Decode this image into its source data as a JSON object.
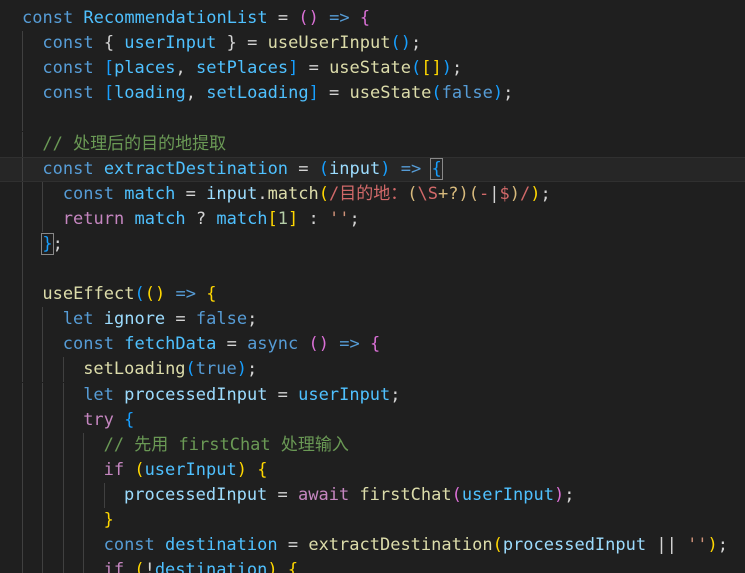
{
  "theme": {
    "background": "#1f1f1f",
    "current_line": "#262626",
    "indent_guide": "#404040",
    "indent_guide_active": "#707070"
  },
  "code_lines": [
    {
      "indent": 0,
      "tokens": [
        [
          "const ",
          "#569cd6"
        ],
        [
          "RecommendationList",
          "#4fc1ff"
        ],
        [
          " = ",
          "#d4d4d4"
        ],
        [
          "()",
          "#da70d6"
        ],
        [
          " ",
          "#d4d4d4"
        ],
        [
          "=>",
          "#569cd6"
        ],
        [
          " ",
          "#d4d4d4"
        ],
        [
          "{",
          "#da70d6"
        ]
      ]
    },
    {
      "indent": 1,
      "tokens": [
        [
          "const ",
          "#569cd6"
        ],
        [
          "{",
          "#d4d4d4"
        ],
        [
          " userInput ",
          "#4fc1ff"
        ],
        [
          "}",
          "#d4d4d4"
        ],
        [
          " = ",
          "#d4d4d4"
        ],
        [
          "useUserInput",
          "#dcdcaa"
        ],
        [
          "()",
          "#179fff"
        ],
        [
          ";",
          "#d4d4d4"
        ]
      ]
    },
    {
      "indent": 1,
      "tokens": [
        [
          "const ",
          "#569cd6"
        ],
        [
          "[",
          "#179fff"
        ],
        [
          "places",
          "#4fc1ff"
        ],
        [
          ", ",
          "#d4d4d4"
        ],
        [
          "setPlaces",
          "#4fc1ff"
        ],
        [
          "]",
          "#179fff"
        ],
        [
          " = ",
          "#d4d4d4"
        ],
        [
          "useState",
          "#dcdcaa"
        ],
        [
          "(",
          "#179fff"
        ],
        [
          "[]",
          "#ffd700"
        ],
        [
          ")",
          "#179fff"
        ],
        [
          ";",
          "#d4d4d4"
        ]
      ]
    },
    {
      "indent": 1,
      "tokens": [
        [
          "const ",
          "#569cd6"
        ],
        [
          "[",
          "#179fff"
        ],
        [
          "loading",
          "#4fc1ff"
        ],
        [
          ", ",
          "#d4d4d4"
        ],
        [
          "setLoading",
          "#4fc1ff"
        ],
        [
          "]",
          "#179fff"
        ],
        [
          " = ",
          "#d4d4d4"
        ],
        [
          "useState",
          "#dcdcaa"
        ],
        [
          "(",
          "#179fff"
        ],
        [
          "false",
          "#569cd6"
        ],
        [
          ")",
          "#179fff"
        ],
        [
          ";",
          "#d4d4d4"
        ]
      ]
    },
    {
      "indent": 1,
      "tokens": []
    },
    {
      "indent": 1,
      "tokens": [
        [
          "// 处理后的目的地提取",
          "#6a9955"
        ]
      ]
    },
    {
      "indent": 1,
      "current": true,
      "tokens": [
        [
          "const ",
          "#569cd6"
        ],
        [
          "extractDestination",
          "#4fc1ff"
        ],
        [
          " = ",
          "#d4d4d4"
        ],
        [
          "(",
          "#179fff"
        ],
        [
          "input",
          "#9cdcfe"
        ],
        [
          ")",
          "#179fff"
        ],
        [
          " ",
          "#d4d4d4"
        ],
        [
          "=>",
          "#569cd6"
        ],
        [
          " ",
          "#d4d4d4"
        ],
        [
          "{",
          "#179fff",
          "bracket"
        ]
      ]
    },
    {
      "indent": 2,
      "tokens": [
        [
          "const ",
          "#569cd6"
        ],
        [
          "match",
          "#4fc1ff"
        ],
        [
          " = ",
          "#d4d4d4"
        ],
        [
          "input",
          "#9cdcfe"
        ],
        [
          ".",
          "#d4d4d4"
        ],
        [
          "match",
          "#dcdcaa"
        ],
        [
          "(",
          "#ffd700"
        ],
        [
          "/",
          "#d16969"
        ],
        [
          "目的地：",
          "#d16969"
        ],
        [
          "(",
          "#d7ba7d"
        ],
        [
          "\\S",
          "#d16969"
        ],
        [
          "+?",
          "#d7ba7d"
        ],
        [
          ")",
          "#d7ba7d"
        ],
        [
          "(",
          "#d7ba7d"
        ],
        [
          "-",
          "#d16969"
        ],
        [
          "|",
          "#d4d4d4"
        ],
        [
          "$",
          "#d16969"
        ],
        [
          ")",
          "#d7ba7d"
        ],
        [
          "/",
          "#d16969"
        ],
        [
          ")",
          "#ffd700"
        ],
        [
          ";",
          "#d4d4d4"
        ]
      ]
    },
    {
      "indent": 2,
      "tokens": [
        [
          "return ",
          "#c586c0"
        ],
        [
          "match",
          "#4fc1ff"
        ],
        [
          " ? ",
          "#d4d4d4"
        ],
        [
          "match",
          "#4fc1ff"
        ],
        [
          "[",
          "#ffd700"
        ],
        [
          "1",
          "#b5cea8"
        ],
        [
          "]",
          "#ffd700"
        ],
        [
          " : ",
          "#d4d4d4"
        ],
        [
          "''",
          "#ce9178"
        ],
        [
          ";",
          "#d4d4d4"
        ]
      ]
    },
    {
      "indent": 1,
      "tokens": [
        [
          "}",
          "#179fff",
          "bracket"
        ],
        [
          ";",
          "#d4d4d4"
        ]
      ]
    },
    {
      "indent": 1,
      "tokens": []
    },
    {
      "indent": 1,
      "tokens": [
        [
          "useEffect",
          "#dcdcaa"
        ],
        [
          "(",
          "#179fff"
        ],
        [
          "()",
          "#ffd700"
        ],
        [
          " ",
          "#d4d4d4"
        ],
        [
          "=>",
          "#569cd6"
        ],
        [
          " ",
          "#d4d4d4"
        ],
        [
          "{",
          "#ffd700"
        ]
      ]
    },
    {
      "indent": 2,
      "tokens": [
        [
          "let ",
          "#569cd6"
        ],
        [
          "ignore",
          "#9cdcfe"
        ],
        [
          " = ",
          "#d4d4d4"
        ],
        [
          "false",
          "#569cd6"
        ],
        [
          ";",
          "#d4d4d4"
        ]
      ]
    },
    {
      "indent": 2,
      "tokens": [
        [
          "const ",
          "#569cd6"
        ],
        [
          "fetchData",
          "#4fc1ff"
        ],
        [
          " = ",
          "#d4d4d4"
        ],
        [
          "async ",
          "#569cd6"
        ],
        [
          "()",
          "#da70d6"
        ],
        [
          " ",
          "#d4d4d4"
        ],
        [
          "=>",
          "#569cd6"
        ],
        [
          " ",
          "#d4d4d4"
        ],
        [
          "{",
          "#da70d6"
        ]
      ]
    },
    {
      "indent": 3,
      "tokens": [
        [
          "setLoading",
          "#dcdcaa"
        ],
        [
          "(",
          "#179fff"
        ],
        [
          "true",
          "#569cd6"
        ],
        [
          ")",
          "#179fff"
        ],
        [
          ";",
          "#d4d4d4"
        ]
      ]
    },
    {
      "indent": 3,
      "tokens": [
        [
          "let ",
          "#569cd6"
        ],
        [
          "processedInput",
          "#9cdcfe"
        ],
        [
          " = ",
          "#d4d4d4"
        ],
        [
          "userInput",
          "#4fc1ff"
        ],
        [
          ";",
          "#d4d4d4"
        ]
      ]
    },
    {
      "indent": 3,
      "tokens": [
        [
          "try ",
          "#c586c0"
        ],
        [
          "{",
          "#179fff"
        ]
      ]
    },
    {
      "indent": 4,
      "tokens": [
        [
          "// 先用 firstChat 处理输入",
          "#6a9955"
        ]
      ]
    },
    {
      "indent": 4,
      "tokens": [
        [
          "if ",
          "#c586c0"
        ],
        [
          "(",
          "#ffd700"
        ],
        [
          "userInput",
          "#4fc1ff"
        ],
        [
          ")",
          "#ffd700"
        ],
        [
          " ",
          "#d4d4d4"
        ],
        [
          "{",
          "#ffd700"
        ]
      ]
    },
    {
      "indent": 5,
      "tokens": [
        [
          "processedInput",
          "#9cdcfe"
        ],
        [
          " = ",
          "#d4d4d4"
        ],
        [
          "await ",
          "#c586c0"
        ],
        [
          "firstChat",
          "#dcdcaa"
        ],
        [
          "(",
          "#da70d6"
        ],
        [
          "userInput",
          "#4fc1ff"
        ],
        [
          ")",
          "#da70d6"
        ],
        [
          ";",
          "#d4d4d4"
        ]
      ]
    },
    {
      "indent": 4,
      "tokens": [
        [
          "}",
          "#ffd700"
        ]
      ]
    },
    {
      "indent": 4,
      "tokens": [
        [
          "const ",
          "#569cd6"
        ],
        [
          "destination",
          "#4fc1ff"
        ],
        [
          " = ",
          "#d4d4d4"
        ],
        [
          "extractDestination",
          "#dcdcaa"
        ],
        [
          "(",
          "#ffd700"
        ],
        [
          "processedInput",
          "#9cdcfe"
        ],
        [
          " || ",
          "#d4d4d4"
        ],
        [
          "''",
          "#ce9178"
        ],
        [
          ")",
          "#ffd700"
        ],
        [
          ";",
          "#d4d4d4"
        ]
      ]
    },
    {
      "indent": 4,
      "tokens": [
        [
          "if ",
          "#c586c0"
        ],
        [
          "(",
          "#ffd700"
        ],
        [
          "!",
          "#d4d4d4"
        ],
        [
          "destination",
          "#4fc1ff"
        ],
        [
          ")",
          "#ffd700"
        ],
        [
          " ",
          "#d4d4d4"
        ],
        [
          "{",
          "#ffd700"
        ]
      ]
    }
  ]
}
